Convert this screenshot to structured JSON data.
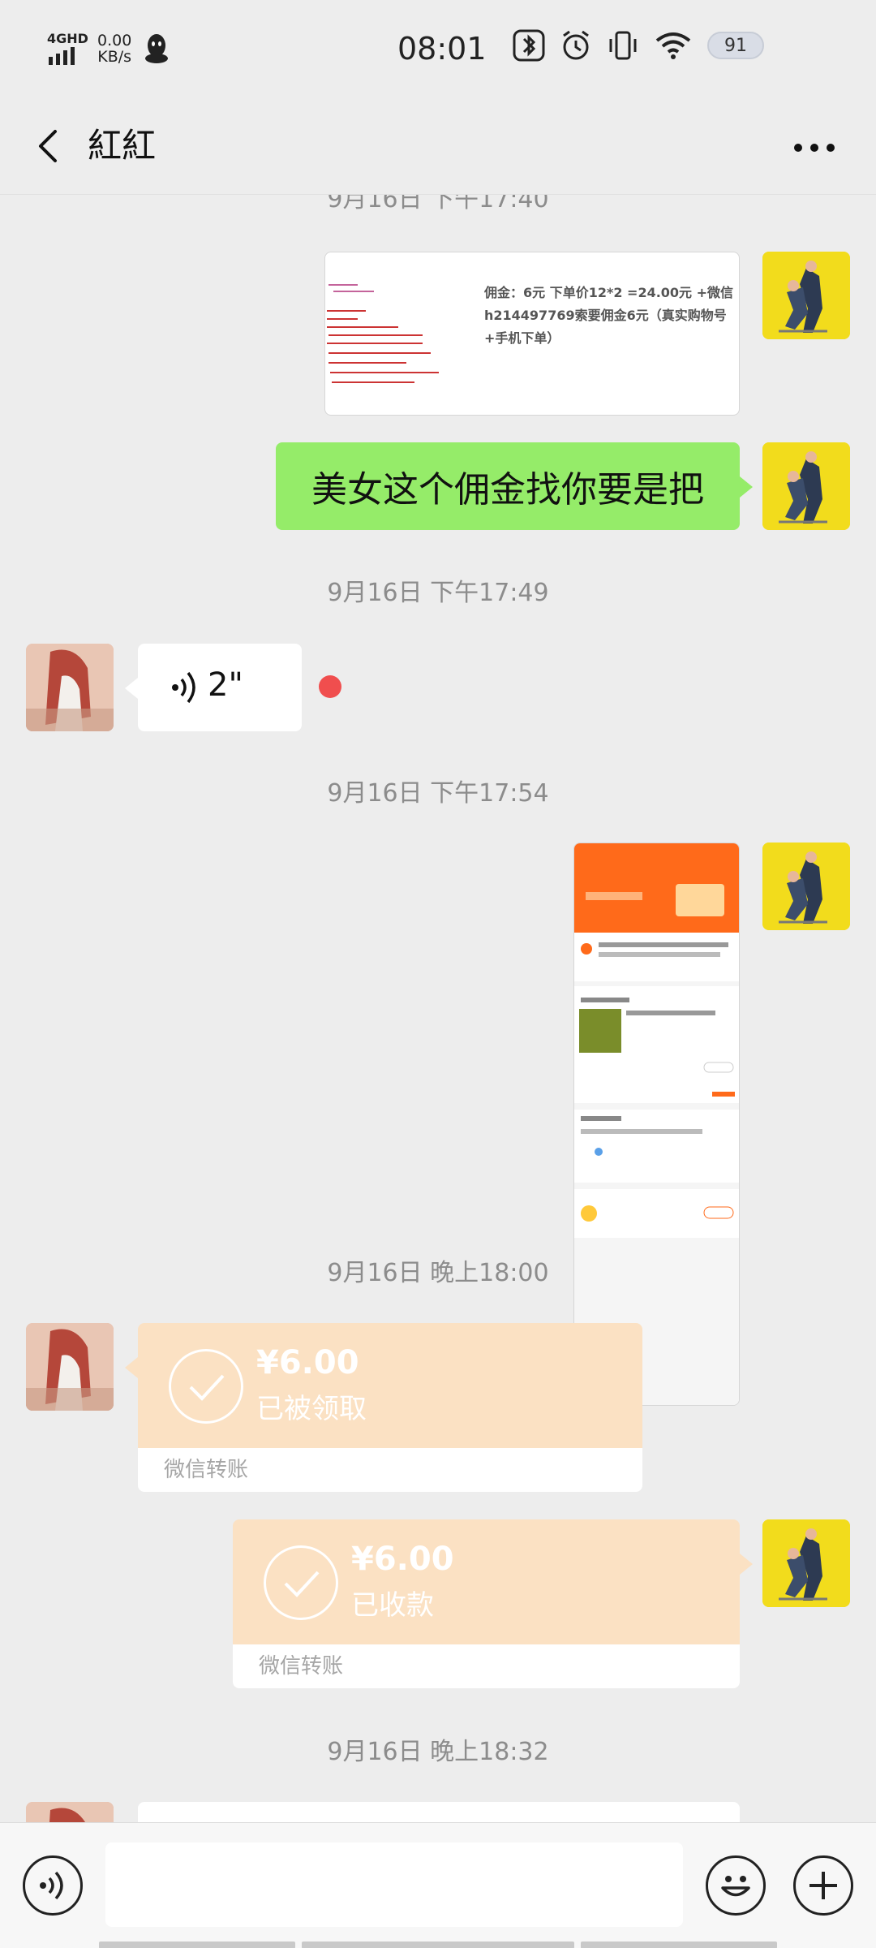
{
  "status_bar": {
    "network": "4GHD",
    "speed_value": "0.00",
    "speed_unit": "KB/s",
    "time": "08:01",
    "battery": "91"
  },
  "header": {
    "title": "紅紅",
    "back_icon": "chevron-left-icon",
    "more_icon": "more-dots-icon"
  },
  "messages": {
    "ts_top": "9月16日 下午17:40",
    "img1_lines": [
      "佣金：6元 下单价12*2 =24.00元 +微信",
      "h214497769索要佣金6元（真实购物号",
      "+手机下单）"
    ],
    "text_msg": "美女这个佣金找你要是把",
    "ts_2": "9月16日 下午17:49",
    "voice_duration": "2\"",
    "ts_3": "9月16日 下午17:54",
    "ts_4": "9月16日 晚上18:00",
    "transfer_received": {
      "amount": "¥6.00",
      "status": "已被领取",
      "label": "微信转账"
    },
    "transfer_sent": {
      "amount": "¥6.00",
      "status": "已收款",
      "label": "微信转账"
    },
    "ts_5": "9月16日 晚上18:32"
  },
  "colors": {
    "green_bubble": "#95ec69",
    "transfer_bg": "#fbe1c3",
    "unread_dot": "#f04e4e",
    "order_orange": "#ff6a1a"
  }
}
